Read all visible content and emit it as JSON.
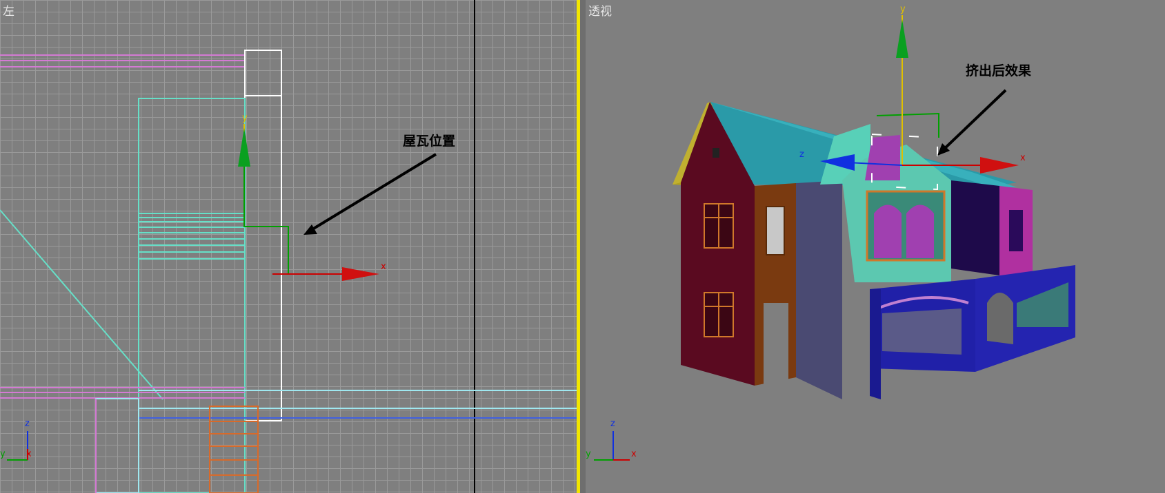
{
  "viewports": {
    "left": {
      "label": "左",
      "annotation": "屋瓦位置"
    },
    "right": {
      "label": "透视",
      "annotation": "挤出后效果"
    }
  },
  "axes": {
    "x": "x",
    "y": "y",
    "z": "z"
  },
  "colors": {
    "active_border": "#f2e600",
    "viewport_bg": "#7f7f7f",
    "axis_x": "#cc0000",
    "axis_y": "#00a000",
    "axis_z": "#1030e0",
    "gizmo_stem": "#e0c000"
  }
}
